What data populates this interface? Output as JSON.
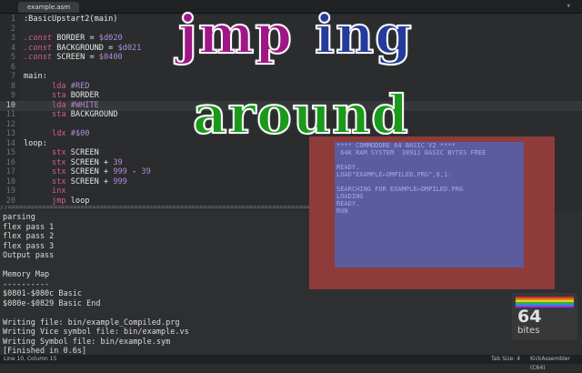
{
  "tabs": [
    {
      "label": "example.asm"
    }
  ],
  "code_lines": [
    {
      "n": "1",
      "t": ":BasicUpstart2(main)"
    },
    {
      "n": "2",
      "t": ""
    },
    {
      "n": "3",
      "t": ".const BORDER = $d020"
    },
    {
      "n": "4",
      "t": ".const BACKGROUND = $d021"
    },
    {
      "n": "5",
      "t": ".const SCREEN = $0400"
    },
    {
      "n": "6",
      "t": ""
    },
    {
      "n": "7",
      "t": "main:"
    },
    {
      "n": "8",
      "t": "      lda #RED"
    },
    {
      "n": "9",
      "t": "      sta BORDER"
    },
    {
      "n": "10",
      "t": "      lda #WHITE"
    },
    {
      "n": "11",
      "t": "      sta BACKGROUND"
    },
    {
      "n": "12",
      "t": ""
    },
    {
      "n": "13",
      "t": "      ldx #$00"
    },
    {
      "n": "14",
      "t": "loop:"
    },
    {
      "n": "15",
      "t": "      stx SCREEN"
    },
    {
      "n": "16",
      "t": "      stx SCREEN + 39"
    },
    {
      "n": "17",
      "t": "      stx SCREEN + 999 - 39"
    },
    {
      "n": "18",
      "t": "      stx SCREEN + 999"
    },
    {
      "n": "19",
      "t": "      inx"
    },
    {
      "n": "20",
      "t": "      jmp loop"
    }
  ],
  "console_lines": [
    "parsing",
    "flex pass 1",
    "flex pass 2",
    "flex pass 3",
    "Output pass",
    "",
    "Memory Map",
    "----------",
    "$0801-$080c Basic",
    "$080e-$0829 Basic End",
    "",
    "Writing file: bin/example_Compiled.prg",
    "Writing Vice symbol file: bin/example.vs",
    "Writing Symbol file: bin/example.sym",
    "[Finished in 0.6s]"
  ],
  "overlay": {
    "word1": "jmp",
    "word2": "ing",
    "word3": "around"
  },
  "emulator": {
    "lines": [
      "**** COMMODORE 64 BASIC V2 ****",
      " 64K RAM SYSTEM  38911 BASIC BYTES FREE",
      "",
      "READY.",
      "LOAD\"EXAMPLE←OMPILED.PRG\",8,1:",
      "",
      "SEARCHING FOR EXAMPLE←OMPILED.PRG",
      "LOADING",
      "READY.",
      "RUN"
    ]
  },
  "status": {
    "position": "Line 10, Column 15",
    "tab_size": "Tab Size: 4",
    "syntax": "KickAssembler (C64)"
  },
  "logo": {
    "number": "64",
    "word": "bites"
  },
  "colors": {
    "keyword": "#d65d8b",
    "number": "#b38cd9",
    "jmp": "#a01687",
    "ing": "#243a9c",
    "around": "#1a9a1a",
    "border": "#8e3b3a",
    "screen": "#5b5b9e"
  }
}
